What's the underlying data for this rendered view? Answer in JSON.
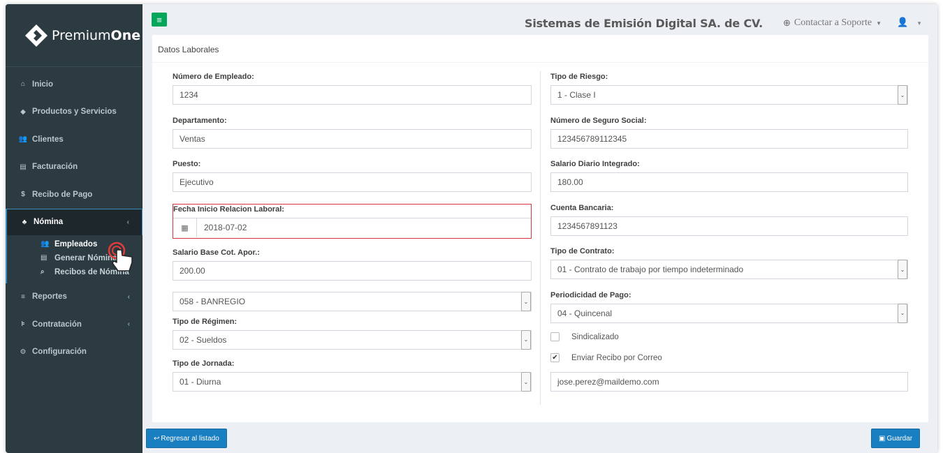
{
  "brand": {
    "name_regular": "Premium",
    "name_bold": "One"
  },
  "header": {
    "company": "Sistemas de Emisión Digital SA. de CV.",
    "support": "Contactar a Soporte",
    "support_icon": "lifebuoy-icon",
    "user_icon": "user-icon"
  },
  "sidebar": {
    "items": [
      {
        "label": "Inicio",
        "icon": "home-icon"
      },
      {
        "label": "Productos y Servicios",
        "icon": "tag-icon"
      },
      {
        "label": "Clientes",
        "icon": "users-icon"
      },
      {
        "label": "Facturación",
        "icon": "file-icon"
      },
      {
        "label": "Recibo de Pago",
        "icon": "dollar-icon"
      },
      {
        "label": "Nómina",
        "icon": "sitemap-icon"
      },
      {
        "label": "Reportes",
        "icon": "list-icon"
      },
      {
        "label": "Contratación",
        "icon": "cart-icon"
      },
      {
        "label": "Configuración",
        "icon": "cogs-icon"
      }
    ],
    "submenu": [
      {
        "label": "Empleados",
        "icon": "users-icon"
      },
      {
        "label": "Generar Nómina",
        "icon": "file-icon"
      },
      {
        "label": "Recibos de Nómina",
        "icon": "search-icon"
      }
    ]
  },
  "form": {
    "title": "Datos Laborales",
    "left": {
      "numero_empleado": {
        "label": "Número de Empleado:",
        "value": "1234"
      },
      "departamento": {
        "label": "Departamento:",
        "value": "Ventas"
      },
      "puesto": {
        "label": "Puesto:",
        "value": "Ejecutivo"
      },
      "fecha_inicio": {
        "label": "Fecha Inicio Relacion Laboral:",
        "value": "2018-07-02"
      },
      "salario_base": {
        "label": "Salario Base Cot. Apor.:",
        "value": "200.00"
      },
      "banco": {
        "value": "058 - BANREGIO"
      },
      "tipo_regimen": {
        "label": "Tipo de Régimen:",
        "value": "02 - Sueldos"
      },
      "tipo_jornada": {
        "label": "Tipo de Jornada:",
        "value": "01 - Diurna"
      }
    },
    "right": {
      "tipo_riesgo": {
        "label": "Tipo de Riesgo:",
        "value": "1 - Clase I"
      },
      "nss": {
        "label": "Número de Seguro Social:",
        "value": "123456789112345"
      },
      "sdi": {
        "label": "Salario Diario Integrado:",
        "value": "180.00"
      },
      "cuenta": {
        "label": "Cuenta Bancaria:",
        "value": "1234567891123"
      },
      "tipo_contrato": {
        "label": "Tipo de Contrato:",
        "value": "01 - Contrato de trabajo por tiempo indeterminado"
      },
      "periodicidad": {
        "label": "Periodicidad de Pago:",
        "value": "04 - Quincenal"
      },
      "sindicalizado": {
        "label": "Sindicalizado",
        "checked": false
      },
      "enviar_recibo": {
        "label": "Enviar Recibo por Correo",
        "checked": true
      },
      "email": {
        "value": "jose.perez@maildemo.com"
      }
    }
  },
  "buttons": {
    "back": "Regresar al listado",
    "save": "Guardar"
  },
  "colors": {
    "sidebar": "#2c3b41",
    "primary": "#1a7fc1",
    "success": "#00a65a",
    "error": "#d9303a"
  }
}
